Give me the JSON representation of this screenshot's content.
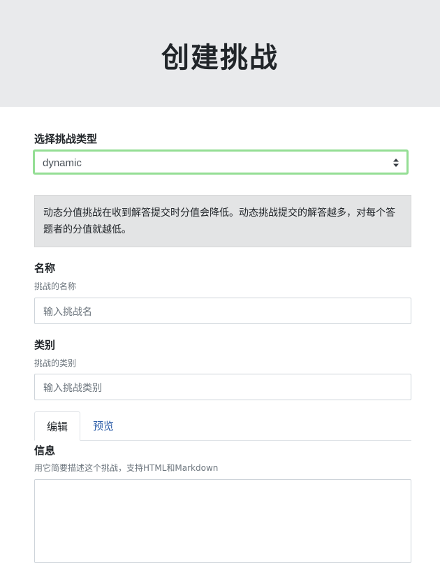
{
  "header": {
    "title": "创建挑战"
  },
  "type_select": {
    "label": "选择挑战类型",
    "value": "dynamic"
  },
  "info_box": {
    "text": "动态分值挑战在收到解答提交时分值会降低。动态挑战提交的解答越多，对每个答题者的分值就越低。"
  },
  "name_field": {
    "label": "名称",
    "help": "挑战的名称",
    "placeholder": "输入挑战名"
  },
  "category_field": {
    "label": "类别",
    "help": "挑战的类别",
    "placeholder": "输入挑战类别"
  },
  "tabs": [
    {
      "label": "编辑"
    },
    {
      "label": "预览"
    }
  ],
  "message_field": {
    "label": "信息",
    "help": "用它简要描述这个挑战，支持HTML和Markdown"
  }
}
